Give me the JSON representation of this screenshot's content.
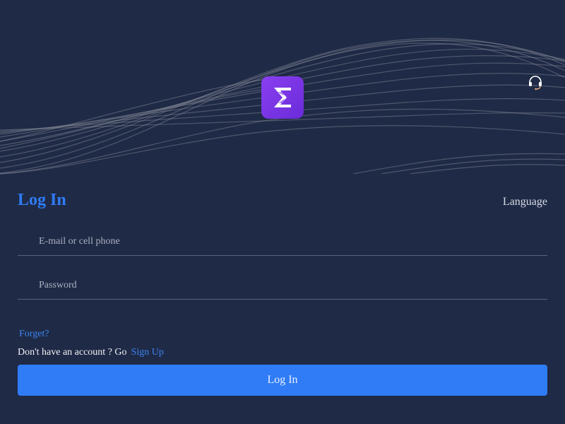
{
  "brand": {
    "logo_icon": "hourglass-logo-icon",
    "accent": "#7a35e6"
  },
  "header": {
    "support_icon": "headset-icon"
  },
  "login": {
    "title": "Log In",
    "language_label": "Language",
    "email_placeholder": "E-mail or cell phone",
    "email_value": "",
    "password_placeholder": "Password",
    "password_value": "",
    "forget_label": "Forget?",
    "no_account_text": "Don't have an account ? Go",
    "signup_label": "Sign Up",
    "submit_label": "Log In"
  },
  "colors": {
    "background": "#1f2a46",
    "primary": "#2f7cf6",
    "link": "#3c84f0"
  }
}
